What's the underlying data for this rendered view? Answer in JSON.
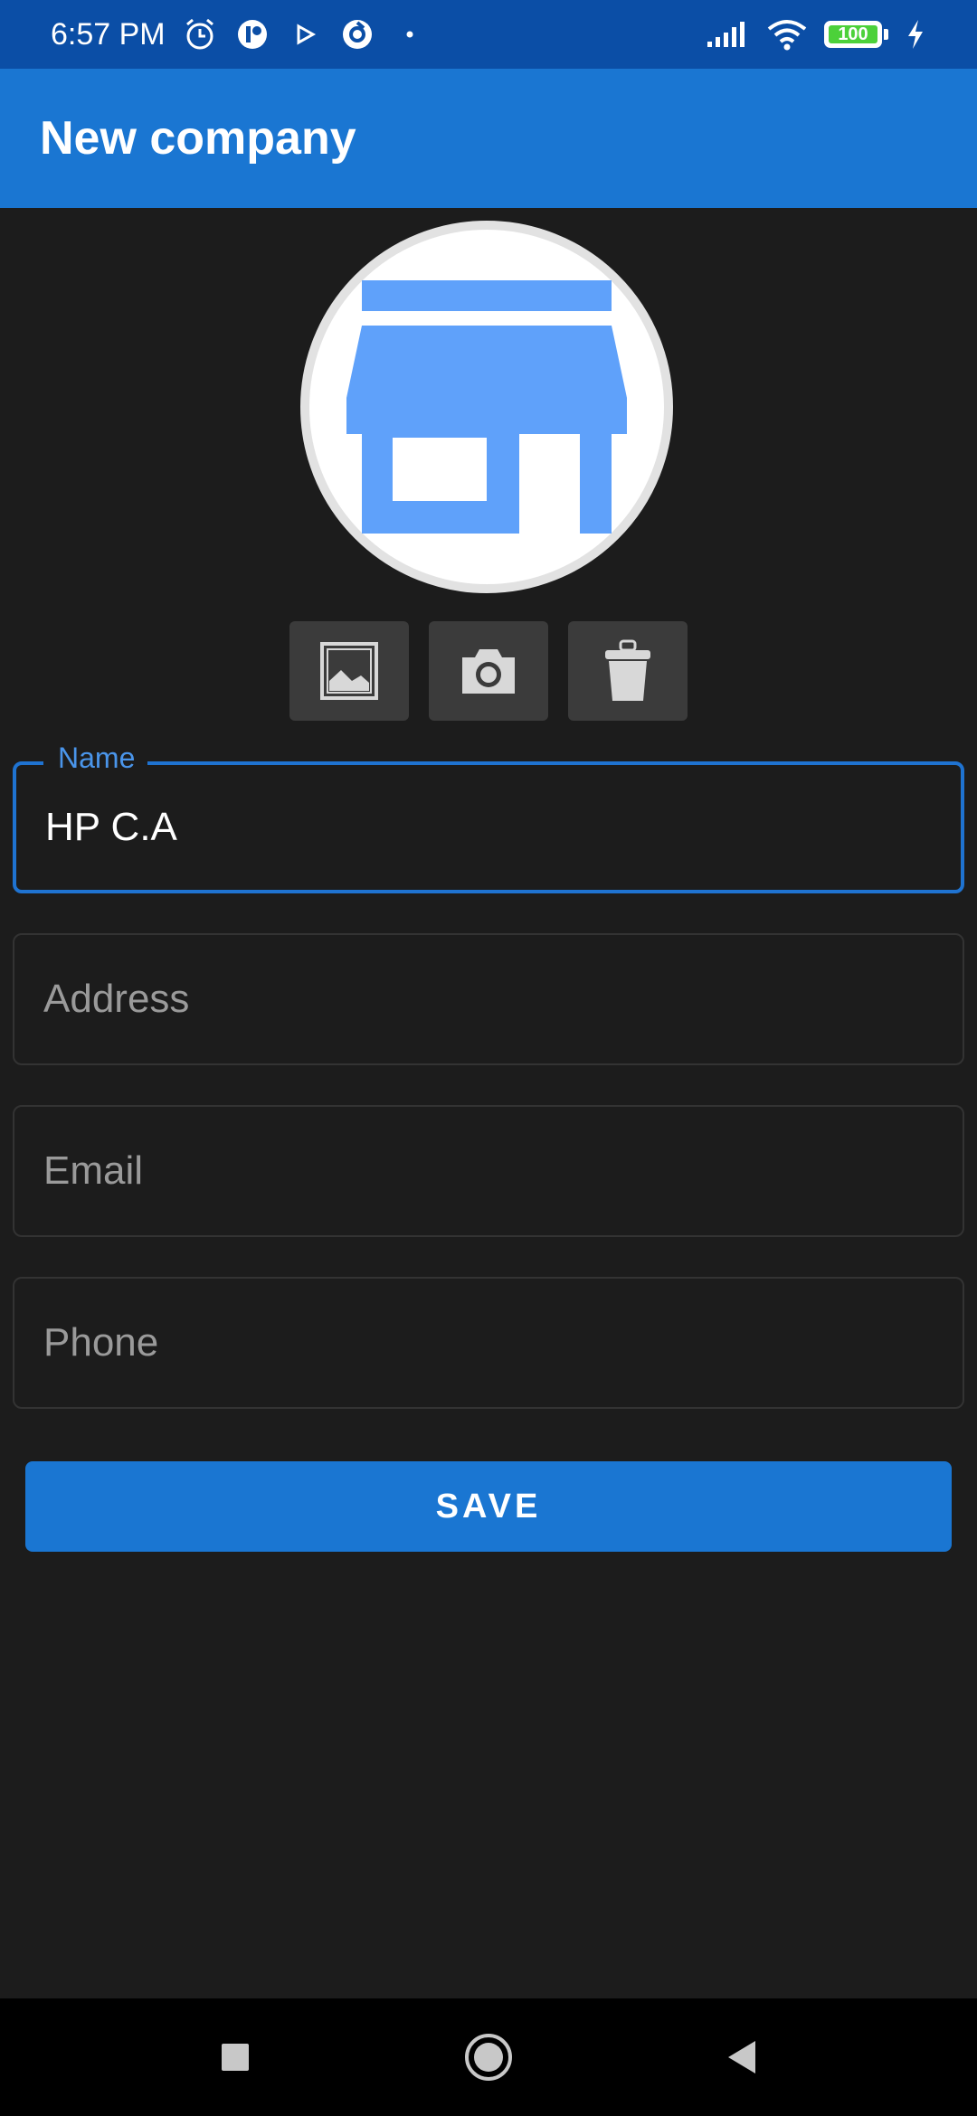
{
  "status_bar": {
    "time": "6:57 PM",
    "battery": "100",
    "icons": [
      "alarm-icon",
      "app-icon",
      "play-icon",
      "sync-icon",
      "dot-icon",
      "signal-icon",
      "wifi-icon",
      "battery-icon",
      "charging-icon"
    ]
  },
  "app_bar": {
    "title": "New company"
  },
  "avatar": {
    "icon": "store-icon",
    "icon_color": "#5fa1fa"
  },
  "actions": [
    {
      "icon": "gallery-icon"
    },
    {
      "icon": "camera-icon"
    },
    {
      "icon": "trash-icon"
    }
  ],
  "form": {
    "name": {
      "label": "Name",
      "value": "HP C.A"
    },
    "address": {
      "placeholder": "Address",
      "value": ""
    },
    "email": {
      "placeholder": "Email",
      "value": ""
    },
    "phone": {
      "placeholder": "Phone",
      "value": ""
    }
  },
  "save_button": {
    "label": "SAVE"
  },
  "colors": {
    "status_bar": "#0b4ea6",
    "app_bar": "#1a76d2",
    "background": "#1c1c1c",
    "accent": "#1f73d1"
  },
  "nav_bar": {
    "icons": [
      "recents-icon",
      "home-icon",
      "back-icon"
    ]
  }
}
